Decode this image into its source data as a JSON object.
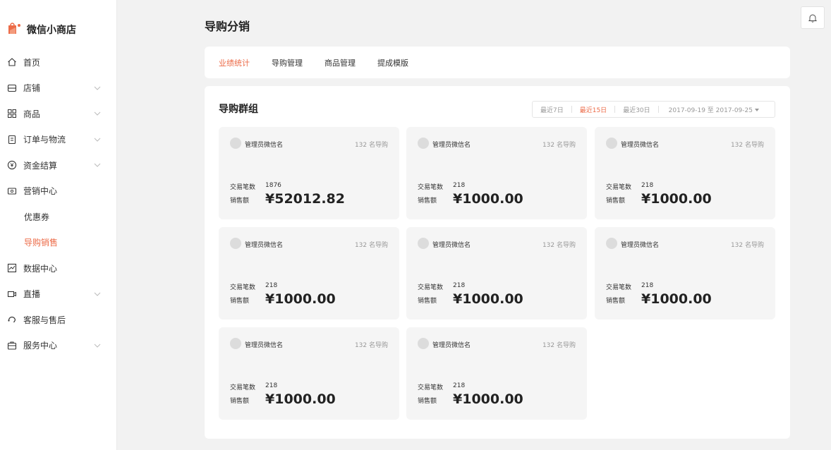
{
  "app": {
    "name": "微信小商店",
    "brand_color": "#ec6b48"
  },
  "sidebar": {
    "items": [
      {
        "label": "首页",
        "icon": "home-icon",
        "has_children": false
      },
      {
        "label": "店铺",
        "icon": "store-icon",
        "has_children": true
      },
      {
        "label": "商品",
        "icon": "grid-icon",
        "has_children": true
      },
      {
        "label": "订单与物流",
        "icon": "order-icon",
        "has_children": true
      },
      {
        "label": "资金结算",
        "icon": "yen-icon",
        "has_children": true
      },
      {
        "label": "营销中心",
        "icon": "ticket-icon",
        "has_children": false
      },
      {
        "label": "优惠券",
        "sub": true
      },
      {
        "label": "导购销售",
        "sub": true,
        "active": true
      },
      {
        "label": "数据中心",
        "icon": "chart-icon",
        "has_children": false
      },
      {
        "label": "直播",
        "icon": "video-icon",
        "has_children": true
      },
      {
        "label": "客服与售后",
        "icon": "headset-icon",
        "has_children": false
      },
      {
        "label": "服务中心",
        "icon": "briefcase-icon",
        "has_children": true
      }
    ]
  },
  "header": {
    "title": "导购分销",
    "bell_icon": "bell-icon"
  },
  "tabs": [
    {
      "label": "业绩统计",
      "active": true
    },
    {
      "label": "导购管理"
    },
    {
      "label": "商品管理"
    },
    {
      "label": "提成模版"
    }
  ],
  "main": {
    "title": "导购群组",
    "range": {
      "options": [
        {
          "label": "最近7日"
        },
        {
          "label": "最近15日",
          "active": true
        },
        {
          "label": "最近30日"
        }
      ],
      "date_range": "2017-09-19 至 2017-09-25"
    },
    "labels": {
      "transactions": "交易笔数",
      "sales": "销售额"
    },
    "groups": [
      {
        "name": "管理员微信名",
        "count": "132 名导购",
        "transactions": "1876",
        "sales": "¥52012.82"
      },
      {
        "name": "管理员微信名",
        "count": "132 名导购",
        "transactions": "218",
        "sales": "¥1000.00"
      },
      {
        "name": "管理员微信名",
        "count": "132 名导购",
        "transactions": "218",
        "sales": "¥1000.00"
      },
      {
        "name": "管理员微信名",
        "count": "132 名导购",
        "transactions": "218",
        "sales": "¥1000.00"
      },
      {
        "name": "管理员微信名",
        "count": "132 名导购",
        "transactions": "218",
        "sales": "¥1000.00"
      },
      {
        "name": "管理员微信名",
        "count": "132 名导购",
        "transactions": "218",
        "sales": "¥1000.00"
      },
      {
        "name": "管理员微信名",
        "count": "132 名导购",
        "transactions": "218",
        "sales": "¥1000.00"
      },
      {
        "name": "管理员微信名",
        "count": "132 名导购",
        "transactions": "218",
        "sales": "¥1000.00"
      }
    ]
  }
}
